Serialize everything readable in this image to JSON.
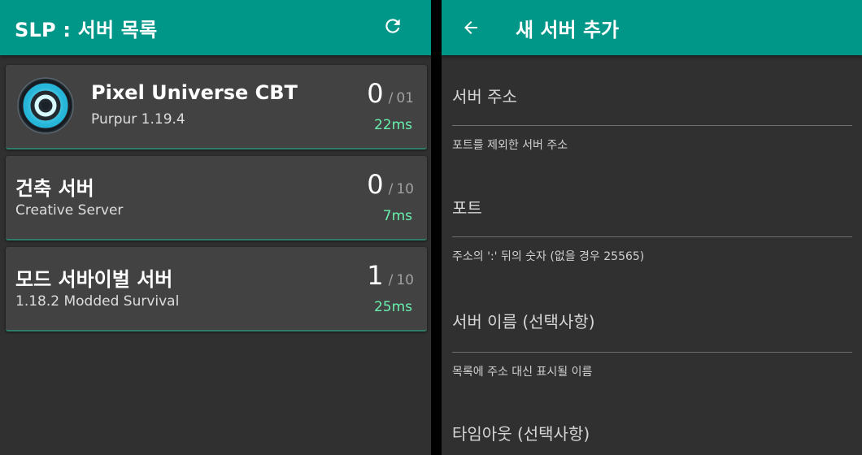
{
  "server_list": {
    "title": "SLP : 서버 목록",
    "servers": [
      {
        "name": "Pixel Universe CBT",
        "subtitle": "Purpur 1.19.4",
        "online": "0",
        "max": "01",
        "ping": "22ms"
      },
      {
        "name": "건축 서버",
        "subtitle": "Creative Server",
        "online": "0",
        "max": "10",
        "ping": "7ms"
      },
      {
        "name": "모드 서바이벌 서버",
        "subtitle": "1.18.2 Modded Survival",
        "online": "1",
        "max": "10",
        "ping": "25ms"
      }
    ]
  },
  "add_server": {
    "title": "새 서버 추가",
    "fields": [
      {
        "label": "서버 주소",
        "hint": "포트를 제외한 서버 주소"
      },
      {
        "label": "포트",
        "hint": "주소의 ':' 뒤의 숫자 (없을 경우 25565)"
      },
      {
        "label": "서버 이름 (선택사항)",
        "hint": "목록에 주소 대신 표시될 이름"
      },
      {
        "label": "타임아웃 (선택사항)"
      }
    ]
  },
  "colors": {
    "accent": "#009688",
    "background": "#303030",
    "card": "#424242",
    "ping": "#69f0ae"
  },
  "icons": [
    "refresh-icon",
    "back-arrow-icon",
    "server-logo-icon"
  ]
}
